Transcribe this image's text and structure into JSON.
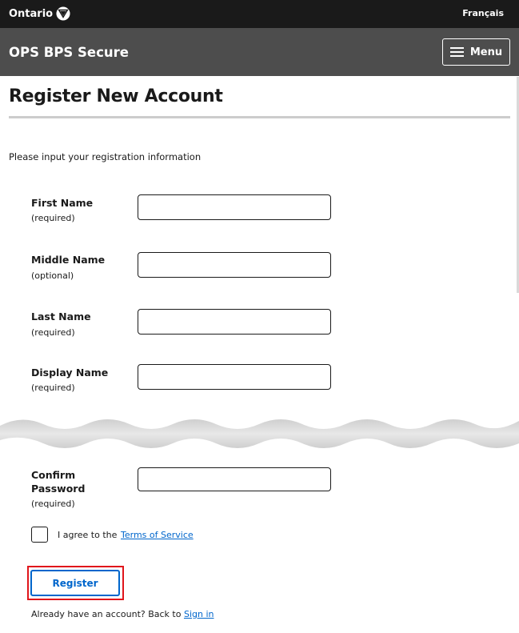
{
  "topbar": {
    "logo_text": "Ontario",
    "language_link": "Français"
  },
  "header": {
    "app_title": "OPS BPS Secure",
    "menu_label": "Menu"
  },
  "page": {
    "title": "Register New Account",
    "intro": "Please input your registration information"
  },
  "form": {
    "first_name": {
      "label": "First Name",
      "hint": "(required)",
      "value": ""
    },
    "middle_name": {
      "label": "Middle Name",
      "hint": "(optional)",
      "value": ""
    },
    "last_name": {
      "label": "Last Name",
      "hint": "(required)",
      "value": ""
    },
    "display_name": {
      "label": "Display Name",
      "hint": "(required)",
      "value": ""
    },
    "confirm_password": {
      "label_line1": "Confirm",
      "label_line2": "Password",
      "hint": "(required)",
      "value": ""
    },
    "agree_prefix": "I agree to the",
    "terms_link": "Terms of Service",
    "agree_checked": false,
    "register_label": "Register",
    "signin_prefix": "Already have an account? Back to",
    "signin_link": "Sign in"
  },
  "colors": {
    "topbar": "#1a1a1a",
    "header": "#4d4d4d",
    "link": "#0066cc",
    "highlight": "#e0151b"
  },
  "icons": {
    "logo": "ontario-trillium-icon",
    "menu": "hamburger-icon"
  }
}
